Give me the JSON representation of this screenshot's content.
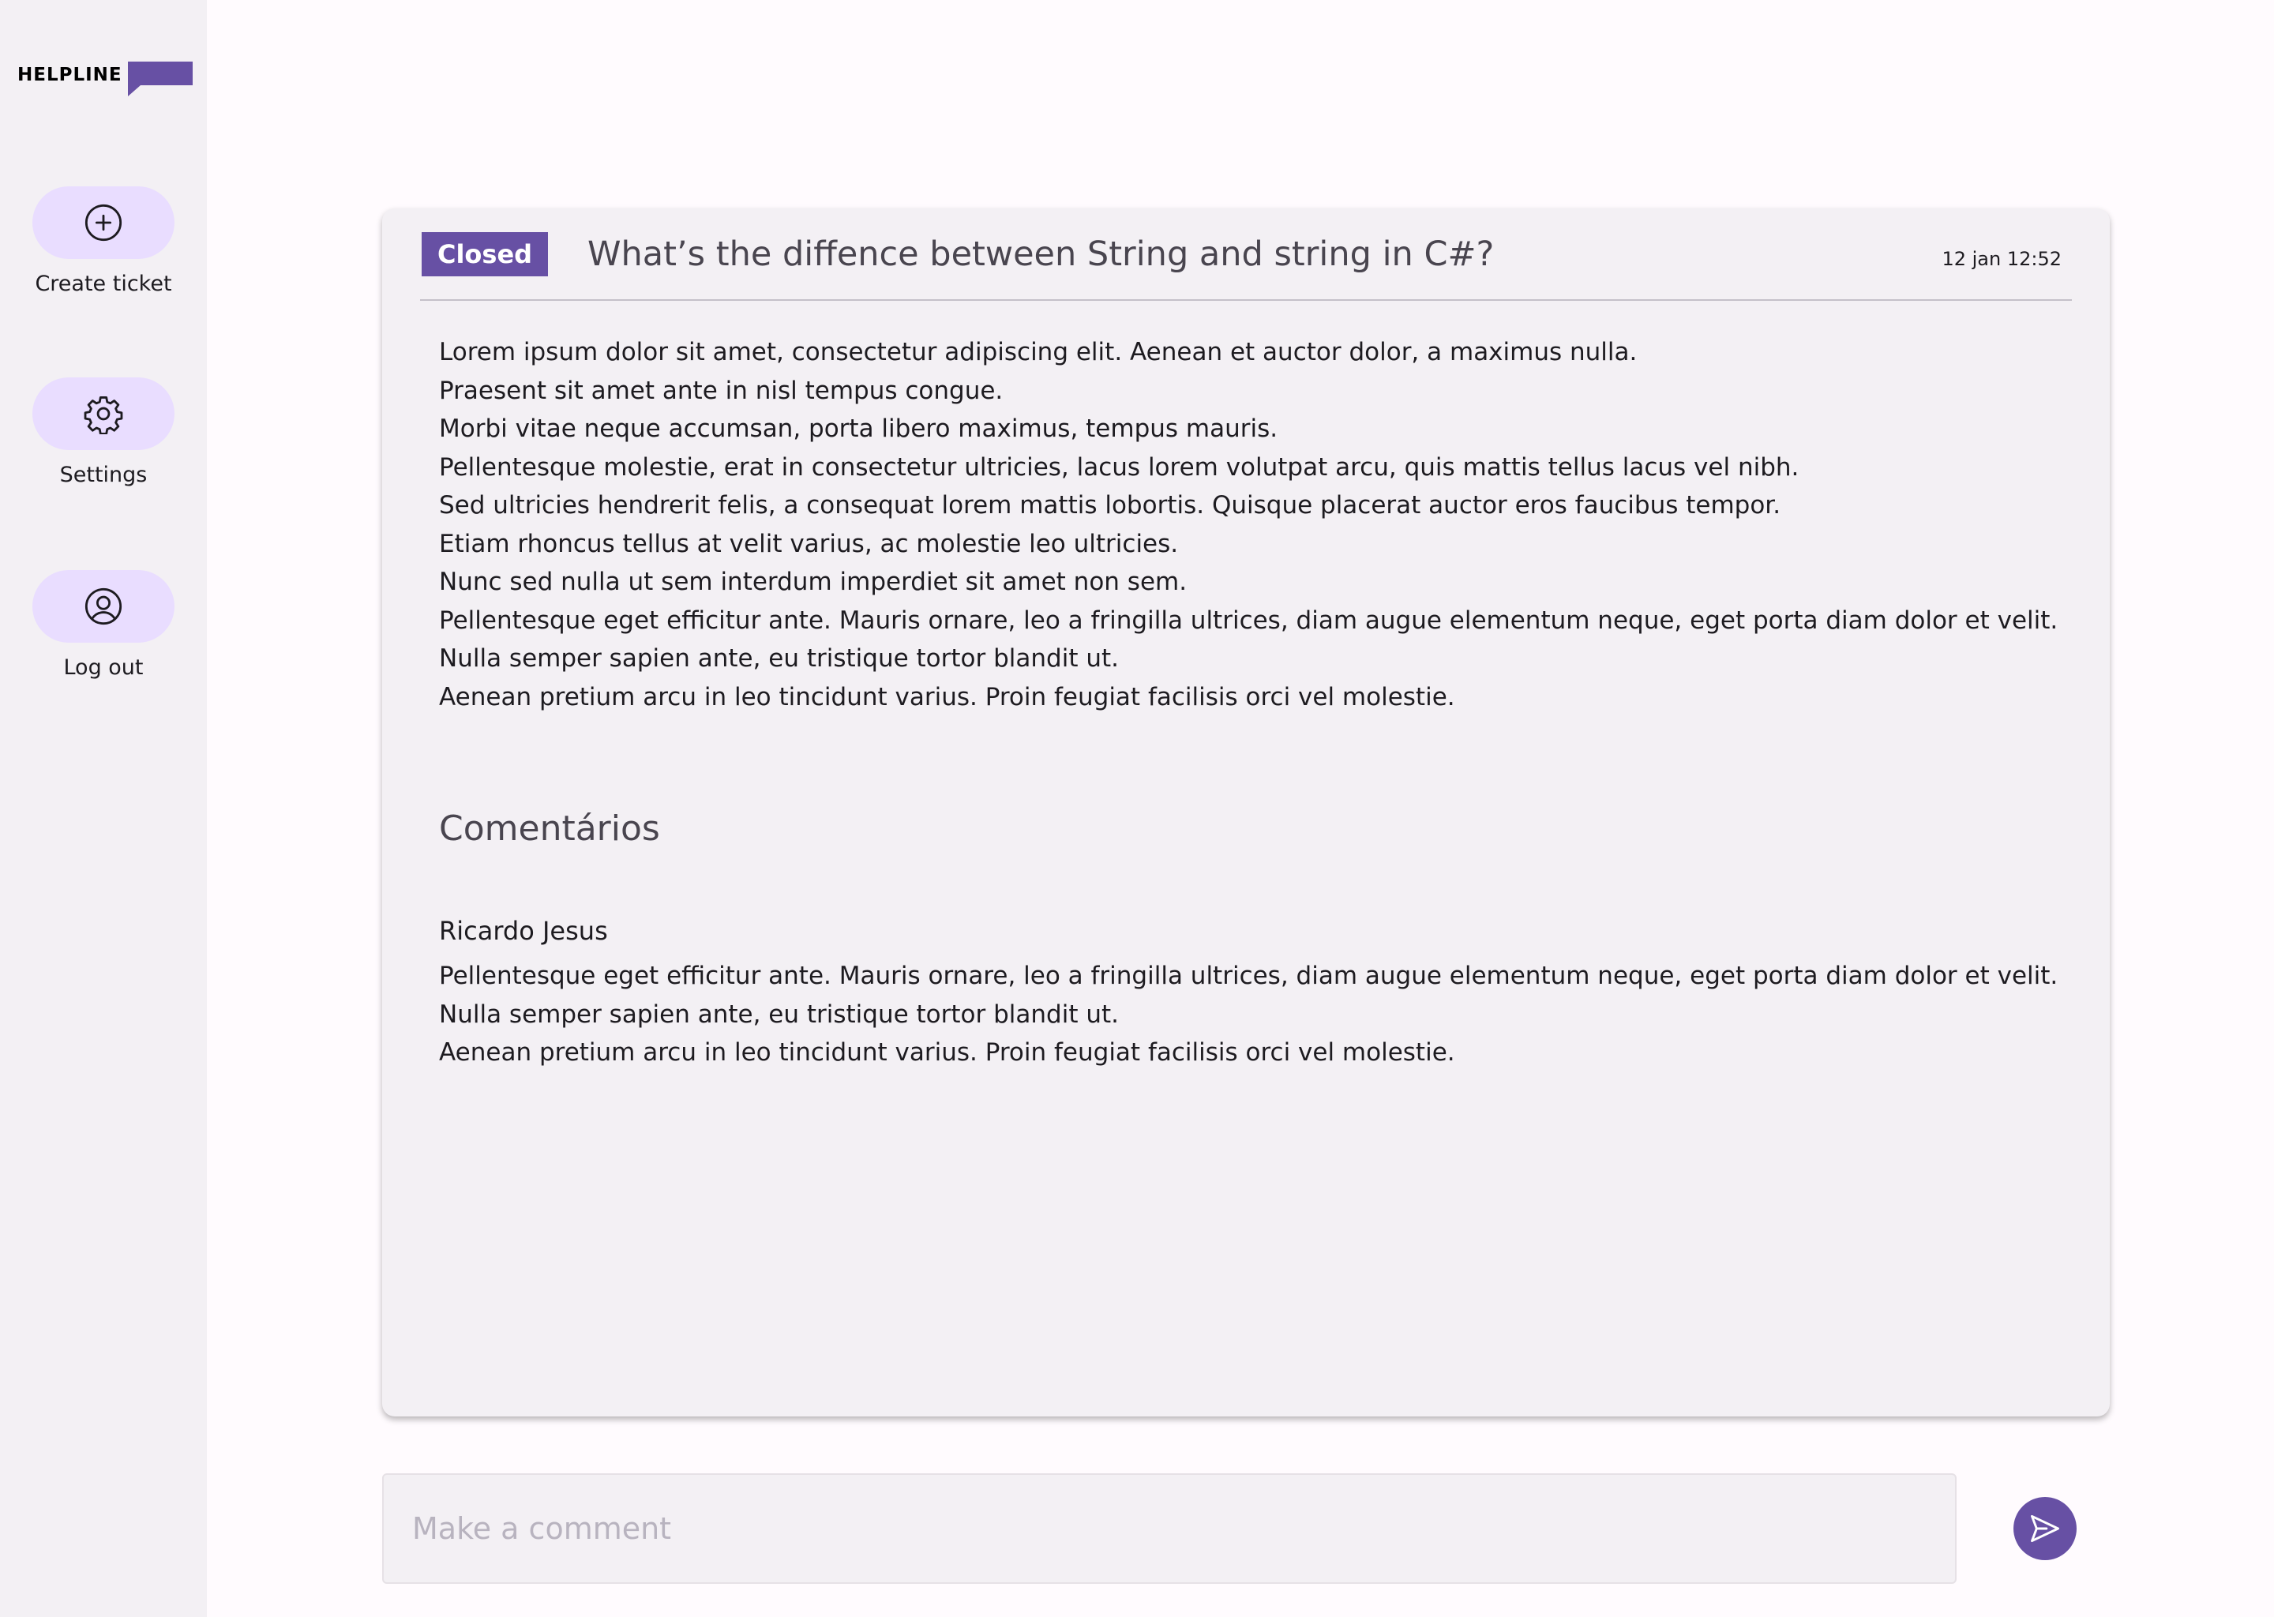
{
  "brand": {
    "name": "HELPLINE",
    "accent": "#6750a4"
  },
  "sidebar": {
    "items": [
      {
        "label": "Create ticket",
        "icon": "plus-circle-icon"
      },
      {
        "label": "Settings",
        "icon": "gear-icon"
      },
      {
        "label": "Log out",
        "icon": "user-circle-icon"
      }
    ]
  },
  "ticket": {
    "status": "Closed",
    "title": "What’s the diffence between String and string in C#?",
    "timestamp": "12 jan 12:52",
    "body": [
      "Lorem ipsum dolor sit amet, consectetur adipiscing elit. Aenean et auctor dolor, a maximus nulla.",
      "Praesent sit amet ante in nisl tempus congue.",
      "Morbi vitae neque accumsan, porta libero maximus, tempus mauris.",
      "Pellentesque molestie, erat in consectetur ultricies, lacus lorem volutpat arcu, quis mattis tellus lacus vel nibh.",
      "Sed ultricies hendrerit felis, a consequat lorem mattis lobortis. Quisque placerat auctor eros faucibus tempor.",
      "Etiam rhoncus tellus at velit varius, ac molestie leo ultricies.",
      "Nunc sed nulla ut sem interdum imperdiet sit amet non sem.",
      "Pellentesque eget efficitur ante. Mauris ornare, leo a fringilla ultrices, diam augue elementum neque, eget porta diam dolor et velit.",
      "Nulla semper sapien ante, eu tristique tortor blandit ut.",
      "Aenean pretium arcu in leo tincidunt varius. Proin feugiat facilisis orci vel molestie."
    ]
  },
  "comments": {
    "heading": "Comentários",
    "items": [
      {
        "author": "Ricardo Jesus",
        "lines": [
          "Pellentesque eget efficitur ante. Mauris ornare, leo a fringilla ultrices, diam augue elementum neque, eget porta diam dolor et velit.",
          "Nulla semper sapien ante, eu tristique tortor blandit ut.",
          "Aenean pretium arcu in leo tincidunt varius. Proin feugiat facilisis orci vel molestie."
        ]
      }
    ]
  },
  "composer": {
    "placeholder": "Make a comment",
    "value": "",
    "send_icon": "send-icon"
  }
}
